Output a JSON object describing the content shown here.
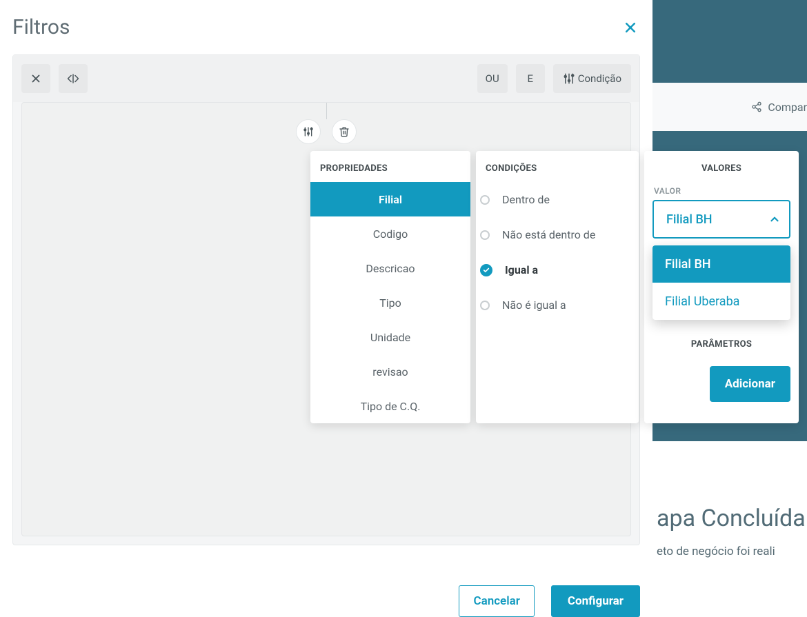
{
  "background": {
    "share_label": "Compar",
    "stage_title": "apa Concluída",
    "stage_subtitle": "eto de negócio foi reali"
  },
  "modal": {
    "title": "Filtros",
    "toolbar": {
      "or_label": "OU",
      "and_label": "E",
      "condition_label": "Condição"
    },
    "properties": {
      "header": "PROPRIEDADES",
      "items": [
        "Filial",
        "Codigo",
        "Descricao",
        "Tipo",
        "Unidade",
        "revisao",
        "Tipo de C.Q."
      ],
      "selected_index": 0
    },
    "conditions": {
      "header": "CONDIÇÕES",
      "items": [
        "Dentro de",
        "Não está dentro de",
        "Igual a",
        "Não é igual a"
      ],
      "selected_index": 2
    },
    "values": {
      "header": "VALORES",
      "field_label": "VALOR",
      "combo_value": "Filial BH",
      "options": [
        "Filial BH",
        "Filial Uberaba"
      ],
      "option_selected_index": 0,
      "params_header": "PARÂMETROS",
      "add_label": "Adicionar"
    },
    "footer": {
      "cancel": "Cancelar",
      "configure": "Configurar"
    }
  }
}
